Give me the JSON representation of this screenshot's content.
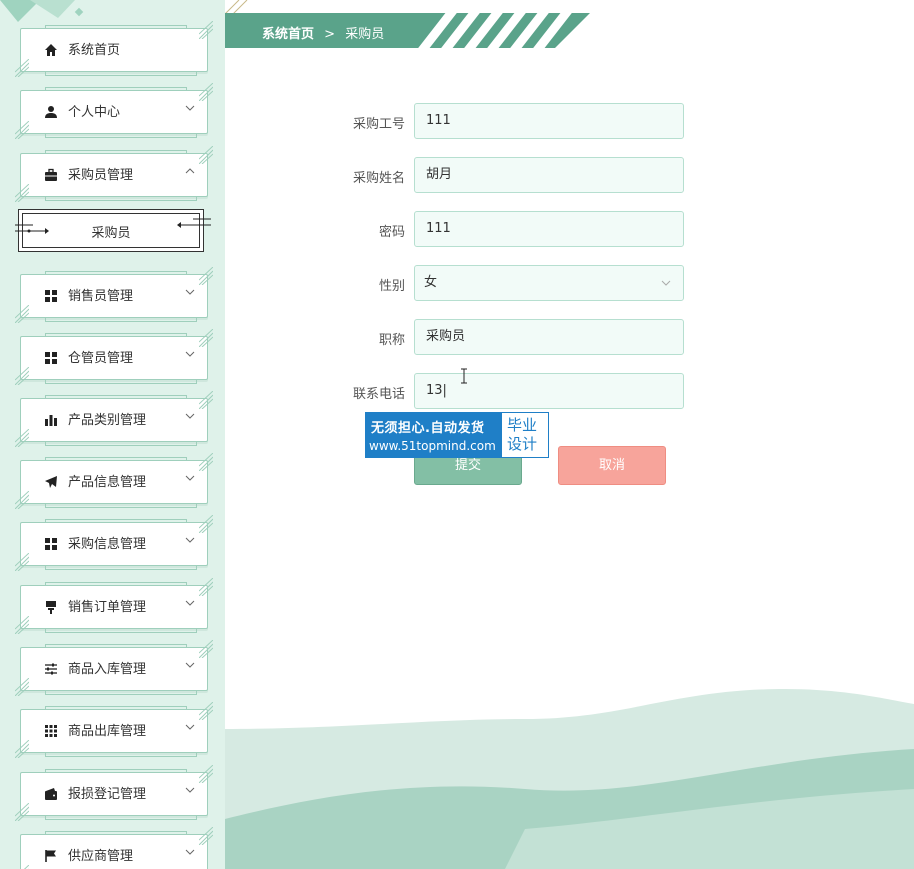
{
  "breadcrumb": {
    "home": "系统首页",
    "separator": ">",
    "current": "采购员"
  },
  "sidebar": {
    "items": [
      {
        "label": "系统首页",
        "icon": "home-icon",
        "chevron": ""
      },
      {
        "label": "个人中心",
        "icon": "user-icon",
        "chevron": "down"
      },
      {
        "label": "采购员管理",
        "icon": "briefcase-icon",
        "chevron": "up"
      },
      {
        "label": "销售员管理",
        "icon": "grid-icon",
        "chevron": "down"
      },
      {
        "label": "仓管员管理",
        "icon": "grid-icon",
        "chevron": "down"
      },
      {
        "label": "产品类别管理",
        "icon": "bar-chart-icon",
        "chevron": "down"
      },
      {
        "label": "产品信息管理",
        "icon": "send-icon",
        "chevron": "down"
      },
      {
        "label": "采购信息管理",
        "icon": "grid-icon",
        "chevron": "down"
      },
      {
        "label": "销售订单管理",
        "icon": "brush-icon",
        "chevron": "down"
      },
      {
        "label": "商品入库管理",
        "icon": "sliders-icon",
        "chevron": "down"
      },
      {
        "label": "商品出库管理",
        "icon": "apps-icon",
        "chevron": "down"
      },
      {
        "label": "报损登记管理",
        "icon": "wallet-icon",
        "chevron": "down"
      },
      {
        "label": "供应商管理",
        "icon": "flag-icon",
        "chevron": "down"
      }
    ],
    "sub_item": {
      "label": "采购员"
    }
  },
  "form": {
    "fields": [
      {
        "label": "采购工号",
        "value": "111"
      },
      {
        "label": "采购姓名",
        "value": "胡月"
      },
      {
        "label": "密码",
        "value": "111"
      },
      {
        "label": "性别",
        "value": "女"
      },
      {
        "label": "职称",
        "value": "采购员"
      },
      {
        "label": "联系电话",
        "value": "13|"
      }
    ],
    "submit_label": "提交",
    "cancel_label": "取消"
  },
  "watermark": {
    "line1": "无须担心.自动发货",
    "line2": "www.51topmind.com",
    "badge_line1": "毕业",
    "badge_line2": "设计"
  },
  "colors": {
    "sidebar_bg": "#dff2ea",
    "accent": "#5aa38a",
    "submit": "#83bfa5",
    "cancel": "#f7a49b",
    "watermark": "#1f7fc7"
  }
}
